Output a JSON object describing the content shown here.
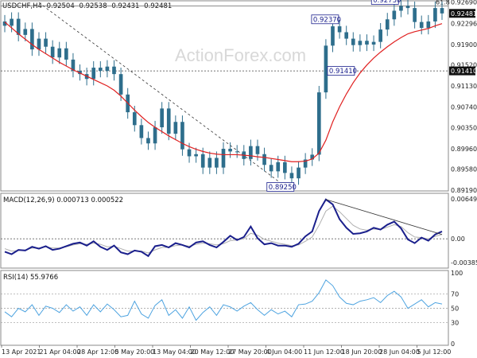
{
  "chart_data": [
    {
      "type": "candlestick",
      "title": "USDCHF,H4",
      "ohlc_readout": [
        "0.92504",
        "0.92538",
        "0.92431",
        "0.92481"
      ],
      "ylim": [
        0.8919,
        0.927
      ],
      "y_ticks": [
        "0.92690",
        "0.92296",
        "0.91900",
        "0.91520",
        "0.91130",
        "0.90740",
        "0.90350",
        "0.89960",
        "0.89580",
        "0.89190"
      ],
      "y_tick_values": [
        0.9269,
        0.92296,
        0.919,
        0.9152,
        0.9113,
        0.9074,
        0.9035,
        0.8996,
        0.8958,
        0.8919
      ],
      "last_price": "0.92481",
      "last_price_value": 0.92481,
      "level_label": "0.91410",
      "level_value": 0.9141,
      "fib_label": "61.8",
      "fib_value": 0.9262,
      "watermark": "ActionForex.com",
      "annotations": [
        {
          "label": "0.92730",
          "value": 0.9273
        },
        {
          "label": "0.92370",
          "value": 0.9237
        },
        {
          "label": "0.91410",
          "value": 0.9141
        },
        {
          "label": "0.89250",
          "value": 0.8925
        }
      ],
      "series": [
        {
          "kind": "close",
          "values": [
            0.9225,
            0.9238,
            0.9208,
            0.9219,
            0.9181,
            0.9201,
            0.9186,
            0.9166,
            0.9183,
            0.9162,
            0.9141,
            0.9135,
            0.9126,
            0.9147,
            0.9141,
            0.9149,
            0.9135,
            0.9097,
            0.9064,
            0.904,
            0.9016,
            0.9006,
            0.9036,
            0.9071,
            0.9024,
            0.9046,
            0.8995,
            0.8982,
            0.8986,
            0.8961,
            0.8979,
            0.8961,
            0.8996,
            0.8991,
            0.8991,
            0.8977,
            0.9001,
            0.8986,
            0.8966,
            0.8954,
            0.8971,
            0.8951,
            0.8941,
            0.8961,
            0.8976,
            0.8985,
            0.9101,
            0.9188,
            0.9224,
            0.9213,
            0.9201,
            0.9189,
            0.9197,
            0.919,
            0.9195,
            0.9218,
            0.9237,
            0.9253,
            0.9262,
            0.9258,
            0.9232,
            0.9221,
            0.9233,
            0.9258,
            0.9248
          ]
        },
        {
          "kind": "moving-average",
          "values": [
            0.9232,
            0.9221,
            0.921,
            0.92,
            0.919,
            0.9181,
            0.9173,
            0.9165,
            0.9157,
            0.915,
            0.9143,
            0.9137,
            0.9131,
            0.9125,
            0.9119,
            0.9113,
            0.9105,
            0.9094,
            0.9081,
            0.9068,
            0.9056,
            0.9045,
            0.9036,
            0.9028,
            0.902,
            0.9013,
            0.9006,
            0.9,
            0.8995,
            0.8991,
            0.8988,
            0.8986,
            0.8985,
            0.8985,
            0.8985,
            0.8984,
            0.8983,
            0.8981,
            0.898,
            0.8978,
            0.8976,
            0.8974,
            0.8972,
            0.8972,
            0.8973,
            0.8977,
            0.8988,
            0.9012,
            0.9046,
            0.9074,
            0.9098,
            0.9119,
            0.9137,
            0.9152,
            0.9165,
            0.9176,
            0.9186,
            0.9195,
            0.9203,
            0.921,
            0.9214,
            0.9217,
            0.922,
            0.9225,
            0.9229
          ]
        }
      ]
    },
    {
      "type": "line",
      "label": "MACD(12,26,9) 0.000713 0.000522",
      "ylim": [
        -0.003855,
        0.00649
      ],
      "y_ticks": [
        "0.00649",
        "0.00",
        "-0.003855"
      ],
      "y_tick_values": [
        0.00649,
        0.0,
        -0.003855
      ],
      "series": [
        {
          "kind": "macd",
          "values": [
            -0.0021,
            -0.0025,
            -0.0018,
            -0.0019,
            -0.0013,
            -0.0016,
            -0.0012,
            -0.0018,
            -0.0016,
            -0.0012,
            -0.0008,
            -0.0006,
            -0.0011,
            -0.0004,
            -0.0013,
            -0.0018,
            -0.0011,
            -0.0022,
            -0.0025,
            -0.0019,
            -0.0021,
            -0.0028,
            -0.0012,
            -0.001,
            -0.0014,
            -0.0007,
            -0.001,
            -0.0014,
            -0.0006,
            -0.0004,
            -0.001,
            -0.0014,
            -0.0005,
            0.0005,
            -0.0002,
            0.0003,
            0.002,
            0.0001,
            -0.0009,
            -0.0007,
            -0.0011,
            -0.0011,
            -0.0013,
            -0.0008,
            0.0004,
            0.0012,
            0.0045,
            0.0064,
            0.0056,
            0.0032,
            0.0018,
            0.0008,
            0.0009,
            0.0012,
            0.0018,
            0.0015,
            0.0023,
            0.0028,
            0.0017,
            -0.0001,
            -0.0007,
            0.0002,
            -0.0003,
            0.0007,
            0.0012
          ]
        },
        {
          "kind": "signal",
          "values": [
            -0.0016,
            -0.002,
            -0.0019,
            -0.0018,
            -0.0015,
            -0.0015,
            -0.0013,
            -0.0015,
            -0.0015,
            -0.0013,
            -0.001,
            -0.0008,
            -0.0009,
            -0.0007,
            -0.0009,
            -0.0013,
            -0.0012,
            -0.0016,
            -0.002,
            -0.002,
            -0.002,
            -0.0023,
            -0.0018,
            -0.0014,
            -0.0014,
            -0.0011,
            -0.001,
            -0.0012,
            -0.0009,
            -0.0007,
            -0.0008,
            -0.001,
            -0.0008,
            -0.0003,
            -0.0002,
            0.0,
            0.0009,
            0.0006,
            -0.0001,
            -0.0004,
            -0.0007,
            -0.0009,
            -0.0011,
            -0.001,
            -0.0004,
            0.0003,
            0.0022,
            0.0045,
            0.0053,
            0.0044,
            0.0033,
            0.0022,
            0.0016,
            0.0014,
            0.0016,
            0.0015,
            0.0019,
            0.0023,
            0.002,
            0.001,
            0.0003,
            0.0002,
            0.0,
            0.0004,
            0.0007
          ]
        }
      ],
      "annotations": [
        "trendline-from-peak"
      ]
    },
    {
      "type": "line",
      "label": "RSI(14) 55.9766",
      "ylim": [
        0,
        100
      ],
      "y_ticks": [
        "100",
        "70",
        "50",
        "30",
        "0"
      ],
      "y_tick_values": [
        100,
        70,
        50,
        30,
        0
      ],
      "series": [
        {
          "kind": "rsi",
          "values": [
            45,
            38,
            50,
            45,
            55,
            40,
            53,
            50,
            44,
            55,
            46,
            52,
            40,
            55,
            45,
            56,
            48,
            38,
            40,
            60,
            42,
            36,
            54,
            62,
            40,
            48,
            36,
            52,
            33,
            44,
            52,
            40,
            55,
            52,
            46,
            53,
            58,
            48,
            40,
            48,
            42,
            46,
            38,
            55,
            56,
            60,
            72,
            90,
            82,
            66,
            57,
            55,
            60,
            62,
            65,
            58,
            68,
            74,
            66,
            50,
            56,
            62,
            52,
            58,
            56
          ]
        }
      ]
    }
  ],
  "x_axis": {
    "labels": [
      "13 Apr 2021",
      "21 Apr 04:00",
      "28 Apr 12:00",
      "5 May 20:00",
      "13 May 04:00",
      "20 May 12:00",
      "27 May 20:00",
      "4 Jun 04:00",
      "11 Jun 12:00",
      "18 Jun 20:00",
      "28 Jun 04:00",
      "5 Jul 12:00"
    ]
  },
  "colors": {
    "candles": "#2e6e8c",
    "ma": "#e02020",
    "macd": "#1a1f8c",
    "signal": "#b0b0b0",
    "rsi": "#4da3e0",
    "tags": "#1a1f8c"
  }
}
